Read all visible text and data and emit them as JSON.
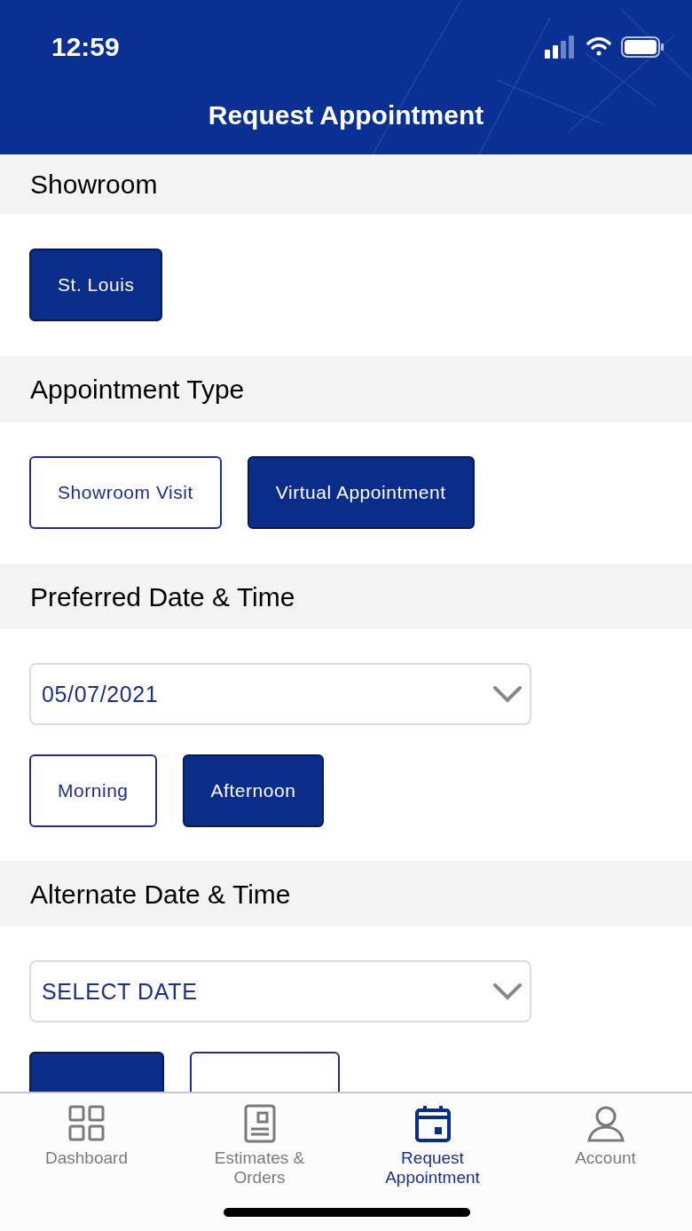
{
  "status_bar": {
    "time": "12:59"
  },
  "header": {
    "title": "Request Appointment"
  },
  "sections": [
    {
      "title": "Showroom",
      "kind": "choices",
      "options": [
        {
          "label": "St. Louis",
          "selected": true
        }
      ]
    },
    {
      "title": "Appointment Type",
      "kind": "choices",
      "options": [
        {
          "label": "Showroom Visit",
          "selected": false
        },
        {
          "label": "Virtual Appointment",
          "selected": true
        }
      ]
    },
    {
      "title": "Preferred Date & Time",
      "kind": "date_time",
      "date": {
        "value": "05/07/2021"
      },
      "options": [
        {
          "label": "Morning",
          "selected": false
        },
        {
          "label": "Afternoon",
          "selected": true
        }
      ]
    },
    {
      "title": "Alternate Date & Time",
      "kind": "date_time",
      "date": {
        "placeholder": "SELECT DATE"
      },
      "options": [
        {
          "selected": true
        },
        {
          "selected": false
        }
      ]
    }
  ],
  "tab_bar": [
    {
      "label": "Dashboard",
      "selected": false
    },
    {
      "label": "Estimates & Orders",
      "selected": false
    },
    {
      "label": "Request Appointment",
      "selected": true
    },
    {
      "label": "Account",
      "selected": false
    }
  ]
}
